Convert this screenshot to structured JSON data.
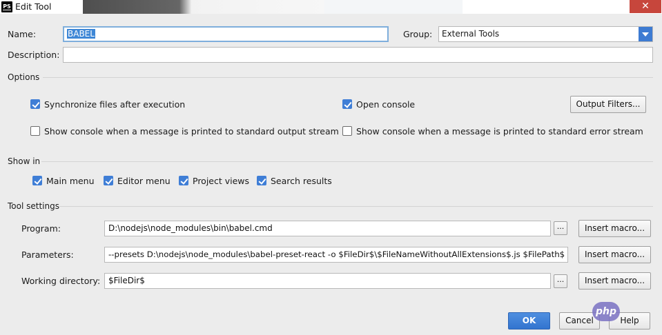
{
  "window": {
    "title": "Edit Tool",
    "app_badge": "PS",
    "close_glyph": "✕"
  },
  "form": {
    "name_label": "Name:",
    "name_value": "BABEL",
    "group_label": "Group:",
    "group_value": "External Tools",
    "description_label": "Description:",
    "description_value": ""
  },
  "options": {
    "section_label": "Options",
    "sync_files": {
      "label": "Synchronize files after execution",
      "checked": true
    },
    "open_console": {
      "label": "Open console",
      "checked": true
    },
    "output_filters_label": "Output Filters...",
    "show_console_stdout": {
      "label": "Show console when a message is printed to standard output stream",
      "checked": false
    },
    "show_console_stderr": {
      "label": "Show console when a message is printed to standard error stream",
      "checked": false
    }
  },
  "show_in": {
    "section_label": "Show in",
    "main_menu": {
      "label": "Main menu",
      "checked": true
    },
    "editor_menu": {
      "label": "Editor menu",
      "checked": true
    },
    "project_views": {
      "label": "Project views",
      "checked": true
    },
    "search_results": {
      "label": "Search results",
      "checked": true
    }
  },
  "tool_settings": {
    "section_label": "Tool settings",
    "program_label": "Program:",
    "program_value": "D:\\nodejs\\node_modules\\bin\\babel.cmd",
    "parameters_label": "Parameters:",
    "parameters_value": "--presets D:\\nodejs\\node_modules\\babel-preset-react -o  $FileDir$\\$FileNameWithoutAllExtensions$.js $FilePath$",
    "working_dir_label": "Working directory:",
    "working_dir_value": "$FileDir$",
    "browse_label": "...",
    "insert_macro_label": "Insert macro..."
  },
  "footer": {
    "ok_label": "OK",
    "cancel_label": "Cancel",
    "help_label": "Help"
  },
  "watermark": "php",
  "colors": {
    "accent": "#3f7ed6",
    "close": "#c7463c"
  }
}
